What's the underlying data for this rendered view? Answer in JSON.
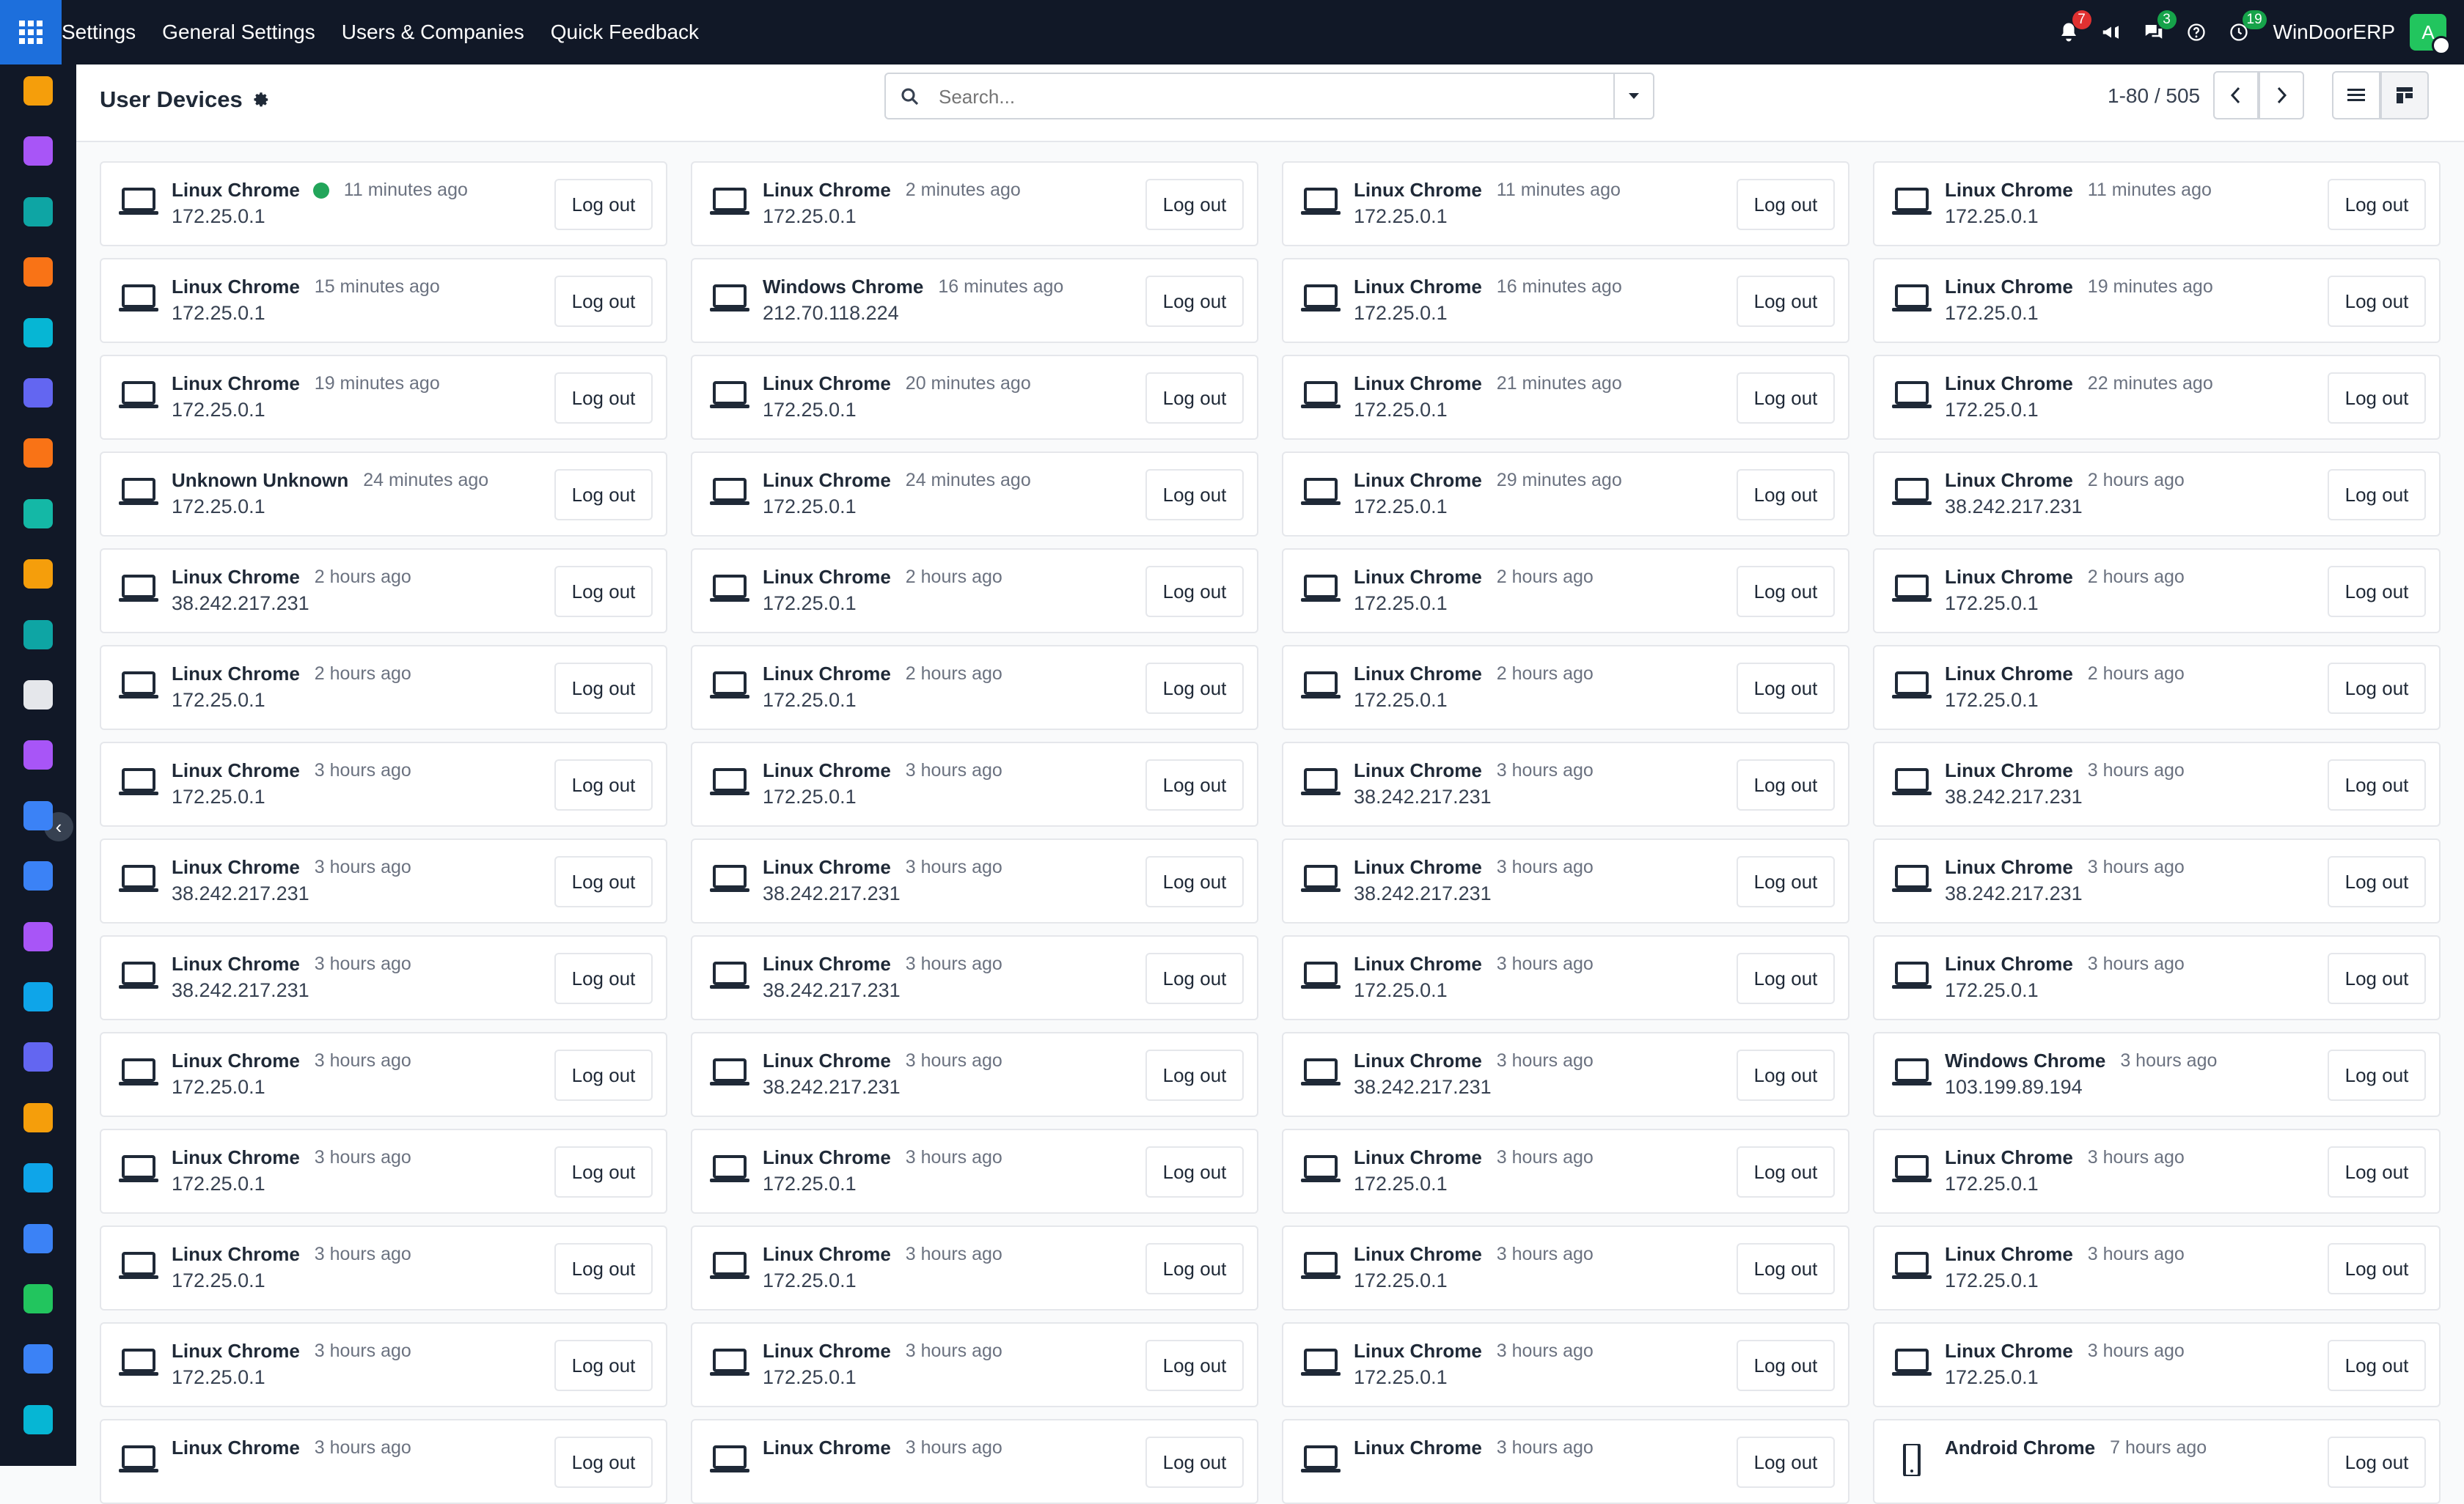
{
  "topbar": {
    "menu": [
      "Settings",
      "General Settings",
      "Users & Companies",
      "Quick Feedback"
    ],
    "notifications_count": "7",
    "messages_count": "3",
    "activity_count": "19",
    "company_name": "WinDoorERP",
    "avatar_initial": "A"
  },
  "sidebar": {
    "icons": [
      "dashboard-icon",
      "studio-icon",
      "contacts-icon",
      "discuss-icon",
      "link-icon",
      "mail-icon",
      "chat-icon",
      "inventory-icon",
      "reports-icon",
      "employees-icon",
      "package-icon",
      "studio-icon-2",
      "tasks-icon",
      "helpdesk-icon",
      "product-icon",
      "invoicing-icon",
      "team-icon",
      "calendar-icon",
      "sign-icon",
      "dashboards-icon",
      "whatsapp-icon",
      "timer-icon",
      "sync-icon"
    ],
    "icon_colors": [
      "#f59e0b",
      "#a855f7",
      "#0ea5a4",
      "#f97316",
      "#06b6d4",
      "#6366f1",
      "#f97316",
      "#14b8a6",
      "#f59e0b",
      "#0ea5a4",
      "#e5e7eb",
      "#a855f7",
      "#3b82f6",
      "#3b82f6",
      "#a855f7",
      "#0ea5e9",
      "#6366f1",
      "#f59e0b",
      "#0ea5e9",
      "#3b82f6",
      "#22c55e",
      "#3b82f6",
      "#06b6d4"
    ]
  },
  "control": {
    "title": "User Devices",
    "search_placeholder": "Search...",
    "pager_text": "1-80 / 505"
  },
  "devices": [
    {
      "name": "Linux Chrome",
      "time": "11 minutes ago",
      "ip": "172.25.0.1",
      "online": true,
      "type": "desktop"
    },
    {
      "name": "Linux Chrome",
      "time": "2 minutes ago",
      "ip": "172.25.0.1",
      "type": "desktop"
    },
    {
      "name": "Linux Chrome",
      "time": "11 minutes ago",
      "ip": "172.25.0.1",
      "type": "desktop"
    },
    {
      "name": "Linux Chrome",
      "time": "11 minutes ago",
      "ip": "172.25.0.1",
      "type": "desktop"
    },
    {
      "name": "Linux Chrome",
      "time": "15 minutes ago",
      "ip": "172.25.0.1",
      "type": "desktop"
    },
    {
      "name": "Windows Chrome",
      "time": "16 minutes ago",
      "ip": "212.70.118.224",
      "type": "desktop"
    },
    {
      "name": "Linux Chrome",
      "time": "16 minutes ago",
      "ip": "172.25.0.1",
      "type": "desktop"
    },
    {
      "name": "Linux Chrome",
      "time": "19 minutes ago",
      "ip": "172.25.0.1",
      "type": "desktop"
    },
    {
      "name": "Linux Chrome",
      "time": "19 minutes ago",
      "ip": "172.25.0.1",
      "type": "desktop"
    },
    {
      "name": "Linux Chrome",
      "time": "20 minutes ago",
      "ip": "172.25.0.1",
      "type": "desktop"
    },
    {
      "name": "Linux Chrome",
      "time": "21 minutes ago",
      "ip": "172.25.0.1",
      "type": "desktop"
    },
    {
      "name": "Linux Chrome",
      "time": "22 minutes ago",
      "ip": "172.25.0.1",
      "type": "desktop"
    },
    {
      "name": "Unknown Unknown",
      "time": "24 minutes ago",
      "ip": "172.25.0.1",
      "type": "desktop"
    },
    {
      "name": "Linux Chrome",
      "time": "24 minutes ago",
      "ip": "172.25.0.1",
      "type": "desktop"
    },
    {
      "name": "Linux Chrome",
      "time": "29 minutes ago",
      "ip": "172.25.0.1",
      "type": "desktop"
    },
    {
      "name": "Linux Chrome",
      "time": "2 hours ago",
      "ip": "38.242.217.231",
      "type": "desktop"
    },
    {
      "name": "Linux Chrome",
      "time": "2 hours ago",
      "ip": "38.242.217.231",
      "type": "desktop"
    },
    {
      "name": "Linux Chrome",
      "time": "2 hours ago",
      "ip": "172.25.0.1",
      "type": "desktop"
    },
    {
      "name": "Linux Chrome",
      "time": "2 hours ago",
      "ip": "172.25.0.1",
      "type": "desktop"
    },
    {
      "name": "Linux Chrome",
      "time": "2 hours ago",
      "ip": "172.25.0.1",
      "type": "desktop"
    },
    {
      "name": "Linux Chrome",
      "time": "2 hours ago",
      "ip": "172.25.0.1",
      "type": "desktop"
    },
    {
      "name": "Linux Chrome",
      "time": "2 hours ago",
      "ip": "172.25.0.1",
      "type": "desktop"
    },
    {
      "name": "Linux Chrome",
      "time": "2 hours ago",
      "ip": "172.25.0.1",
      "type": "desktop"
    },
    {
      "name": "Linux Chrome",
      "time": "2 hours ago",
      "ip": "172.25.0.1",
      "type": "desktop"
    },
    {
      "name": "Linux Chrome",
      "time": "3 hours ago",
      "ip": "172.25.0.1",
      "type": "desktop"
    },
    {
      "name": "Linux Chrome",
      "time": "3 hours ago",
      "ip": "172.25.0.1",
      "type": "desktop"
    },
    {
      "name": "Linux Chrome",
      "time": "3 hours ago",
      "ip": "38.242.217.231",
      "type": "desktop"
    },
    {
      "name": "Linux Chrome",
      "time": "3 hours ago",
      "ip": "38.242.217.231",
      "type": "desktop"
    },
    {
      "name": "Linux Chrome",
      "time": "3 hours ago",
      "ip": "38.242.217.231",
      "type": "desktop"
    },
    {
      "name": "Linux Chrome",
      "time": "3 hours ago",
      "ip": "38.242.217.231",
      "type": "desktop"
    },
    {
      "name": "Linux Chrome",
      "time": "3 hours ago",
      "ip": "38.242.217.231",
      "type": "desktop"
    },
    {
      "name": "Linux Chrome",
      "time": "3 hours ago",
      "ip": "38.242.217.231",
      "type": "desktop"
    },
    {
      "name": "Linux Chrome",
      "time": "3 hours ago",
      "ip": "38.242.217.231",
      "type": "desktop"
    },
    {
      "name": "Linux Chrome",
      "time": "3 hours ago",
      "ip": "38.242.217.231",
      "type": "desktop"
    },
    {
      "name": "Linux Chrome",
      "time": "3 hours ago",
      "ip": "172.25.0.1",
      "type": "desktop"
    },
    {
      "name": "Linux Chrome",
      "time": "3 hours ago",
      "ip": "172.25.0.1",
      "type": "desktop"
    },
    {
      "name": "Linux Chrome",
      "time": "3 hours ago",
      "ip": "172.25.0.1",
      "type": "desktop"
    },
    {
      "name": "Linux Chrome",
      "time": "3 hours ago",
      "ip": "38.242.217.231",
      "type": "desktop"
    },
    {
      "name": "Linux Chrome",
      "time": "3 hours ago",
      "ip": "38.242.217.231",
      "type": "desktop"
    },
    {
      "name": "Windows Chrome",
      "time": "3 hours ago",
      "ip": "103.199.89.194",
      "type": "desktop"
    },
    {
      "name": "Linux Chrome",
      "time": "3 hours ago",
      "ip": "172.25.0.1",
      "type": "desktop"
    },
    {
      "name": "Linux Chrome",
      "time": "3 hours ago",
      "ip": "172.25.0.1",
      "type": "desktop"
    },
    {
      "name": "Linux Chrome",
      "time": "3 hours ago",
      "ip": "172.25.0.1",
      "type": "desktop"
    },
    {
      "name": "Linux Chrome",
      "time": "3 hours ago",
      "ip": "172.25.0.1",
      "type": "desktop"
    },
    {
      "name": "Linux Chrome",
      "time": "3 hours ago",
      "ip": "172.25.0.1",
      "type": "desktop"
    },
    {
      "name": "Linux Chrome",
      "time": "3 hours ago",
      "ip": "172.25.0.1",
      "type": "desktop"
    },
    {
      "name": "Linux Chrome",
      "time": "3 hours ago",
      "ip": "172.25.0.1",
      "type": "desktop"
    },
    {
      "name": "Linux Chrome",
      "time": "3 hours ago",
      "ip": "172.25.0.1",
      "type": "desktop"
    },
    {
      "name": "Linux Chrome",
      "time": "3 hours ago",
      "ip": "172.25.0.1",
      "type": "desktop"
    },
    {
      "name": "Linux Chrome",
      "time": "3 hours ago",
      "ip": "172.25.0.1",
      "type": "desktop"
    },
    {
      "name": "Linux Chrome",
      "time": "3 hours ago",
      "ip": "172.25.0.1",
      "type": "desktop"
    },
    {
      "name": "Linux Chrome",
      "time": "3 hours ago",
      "ip": "172.25.0.1",
      "type": "desktop"
    },
    {
      "name": "Linux Chrome",
      "time": "3 hours ago",
      "ip": "",
      "type": "desktop"
    },
    {
      "name": "Linux Chrome",
      "time": "3 hours ago",
      "ip": "",
      "type": "desktop"
    },
    {
      "name": "Linux Chrome",
      "time": "3 hours ago",
      "ip": "",
      "type": "desktop"
    },
    {
      "name": "Android Chrome",
      "time": "7 hours ago",
      "ip": "",
      "type": "mobile"
    }
  ],
  "logout_label": "Log out",
  "colors": {
    "topbar_bg": "#111827",
    "apps_button": "#1d6fdc",
    "online_dot": "#22a55a",
    "badge_red": "#e03131",
    "badge_green": "#16a34a"
  }
}
